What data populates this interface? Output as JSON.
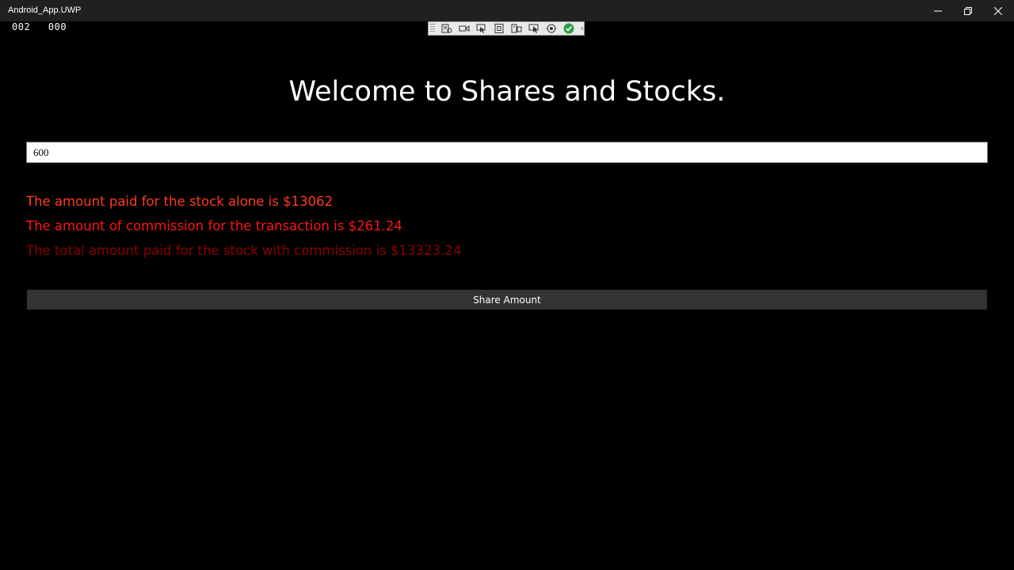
{
  "window": {
    "title": "Android_App.UWP",
    "controls": {
      "minimize": "minimize-icon",
      "restore": "restore-icon",
      "close": "close-icon"
    }
  },
  "frame_counter": {
    "first": "002",
    "second": "000"
  },
  "debug_toolbar": {
    "icons": [
      "live-visual-tree-icon",
      "record-icon",
      "select-element-icon",
      "display-layout-adorners-icon",
      "track-focused-element-icon",
      "preview-selection-icon",
      "hot-reload-icon",
      "hot-reload-status-check-icon"
    ],
    "collapse_glyph": "‹"
  },
  "main": {
    "heading": "Welcome to Shares and Stocks.",
    "input": {
      "value": "600"
    },
    "results": {
      "stock_alone": "The amount paid for the stock alone is $13062",
      "commission": "The amount of commission for the transaction is $261.24",
      "total": "The total amount paid for the stock with commission is $13323.24"
    },
    "share_button_label": "Share Amount"
  },
  "colors": {
    "background": "#000000",
    "titlebar": "#202020",
    "result_1": "#ff3b1f",
    "result_2": "#ff1414",
    "result_3": "#8b0000",
    "button": "#333333",
    "hot_reload_ok": "#2ea043"
  }
}
